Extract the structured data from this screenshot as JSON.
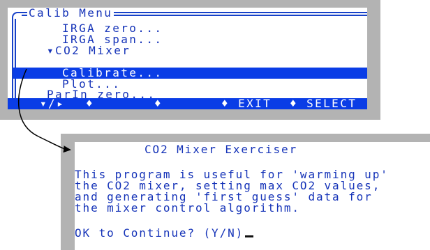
{
  "menu": {
    "title": "Calib Menu",
    "items": [
      {
        "label": "IRGA zero..."
      },
      {
        "label": "IRGA span..."
      },
      {
        "label": "▾CO2 Mixer"
      },
      {
        "label": "Calibrate...",
        "selected": true
      },
      {
        "label": "Plot..."
      },
      {
        "label": "ParIn zero..."
      }
    ],
    "function_keys": [
      {
        "label": "▾/▸"
      },
      {
        "label": "♦"
      },
      {
        "label": "♦"
      },
      {
        "label": "♦ EXIT"
      },
      {
        "label": "♦ SELECT"
      }
    ]
  },
  "dialog": {
    "title": "CO2 Mixer Exerciser",
    "body_lines": [
      "This program is useful for 'warming up'",
      "the CO2 mixer, setting max CO2 values,",
      "and generating 'first guess' data for",
      "the mixer control algorithm."
    ],
    "prompt": "OK to Continue? (Y/N)"
  },
  "colors": {
    "terminal_text": "#1533b8",
    "highlight_bar": "#0a3de6",
    "bezel": "#b3b3b3",
    "screen": "#ffffff"
  }
}
